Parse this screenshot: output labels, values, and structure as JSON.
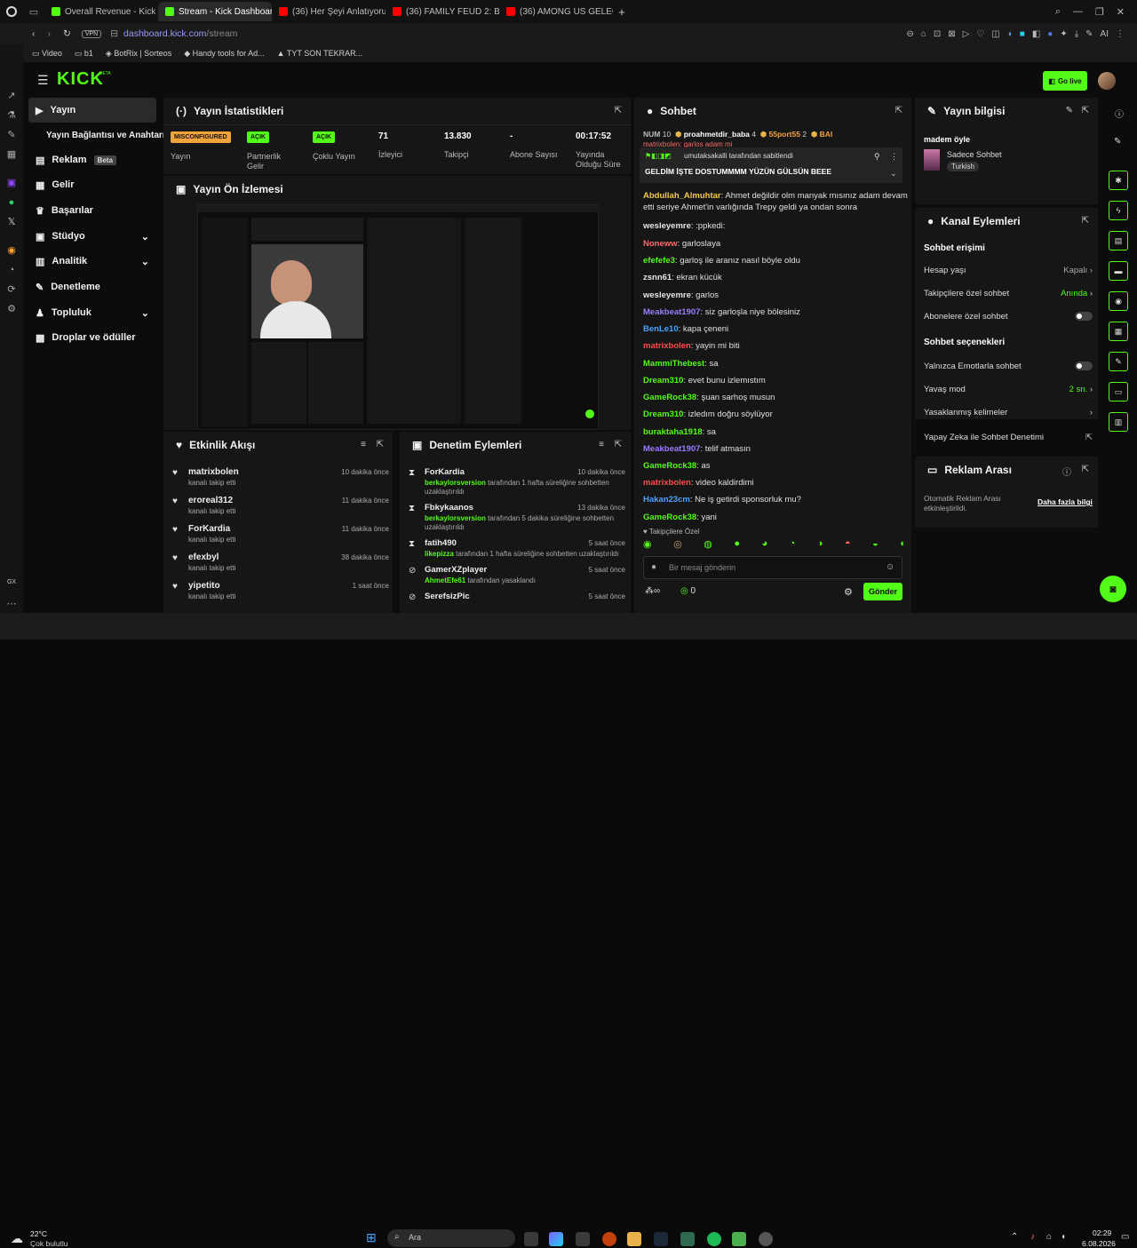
{
  "browser": {
    "tabs": [
      {
        "label": "Overall Revenue - Kick Da",
        "color": "#53fc18"
      },
      {
        "label": "Stream - Kick Dashboard",
        "color": "#53fc18",
        "active": true
      },
      {
        "label": "(36) Her Şeyi Anlatıyorum",
        "color": "#ff0000"
      },
      {
        "label": "(36) FAMILY FEUD 2: BETA",
        "color": "#ff0000"
      },
      {
        "label": "(36) AMONG US GELECEK",
        "color": "#ff0000"
      }
    ],
    "new_tab": "+",
    "vpn": "VPN",
    "url_host": "dashboard.kick.com",
    "url_path": "/stream",
    "ai_label": "AI",
    "bookmarks": [
      "Video",
      "b1",
      "BotRix | Sorteos",
      "Handy tools for Ad...",
      "TYT SON TEKRAR..."
    ]
  },
  "app": {
    "logo": "KICK",
    "logo_tag": "BETA",
    "go_live": "Go live",
    "accent": "#53fc18"
  },
  "sidenav": {
    "items": [
      {
        "label": "Yayın",
        "icon": "broadcast-icon"
      },
      {
        "label": "Yayın Bağlantısı ve Anahtarı",
        "icon": ""
      },
      {
        "label": "Reklam",
        "badge": "Beta",
        "icon": "ad-icon"
      },
      {
        "label": "Gelir",
        "icon": "revenue-icon"
      },
      {
        "label": "Başarılar",
        "icon": "trophy-icon"
      },
      {
        "label": "Stüdyo",
        "icon": "studio-icon"
      },
      {
        "label": "Analitik",
        "icon": "analytics-icon"
      },
      {
        "label": "Denetleme",
        "icon": "moderation-icon"
      },
      {
        "label": "Topluluk",
        "icon": "community-icon"
      },
      {
        "label": "Droplar ve ödüller",
        "icon": "drops-icon"
      }
    ]
  },
  "stats": {
    "title": "Yayın İstatistikleri",
    "items": [
      {
        "value": "MISCONFIGURED",
        "label": "Yayın",
        "badge": "orange"
      },
      {
        "value": "AÇIK",
        "label": "Partnerlik Gelir",
        "badge": "green"
      },
      {
        "value": "AÇIK",
        "label": "Çoklu Yayın",
        "badge": "green"
      },
      {
        "value": "71",
        "label": "İzleyici"
      },
      {
        "value": "13.830",
        "label": "Takipçi"
      },
      {
        "value": "-",
        "label": "Abone Sayısı"
      },
      {
        "value": "00:17:52",
        "label": "Yayında Olduğu Süre"
      }
    ]
  },
  "preview": {
    "title": "Yayın Ön İzlemesi"
  },
  "activity": {
    "title": "Etkinlik Akışı",
    "items": [
      {
        "name": "matrixbolen",
        "sub": "kanalı takip etti",
        "time": "10 dakika önce"
      },
      {
        "name": "eroreal312",
        "sub": "kanalı takip etti",
        "time": "11 dakika önce"
      },
      {
        "name": "ForKardia",
        "sub": "kanalı takip etti",
        "time": "11 dakika önce"
      },
      {
        "name": "efexbyl",
        "sub": "kanalı takip etti",
        "time": "38 dakika önce"
      },
      {
        "name": "yipetito",
        "sub": "kanalı takip etti",
        "time": "1 saat önce"
      }
    ]
  },
  "modlog": {
    "title": "Denetim Eylemleri",
    "items": [
      {
        "name": "ForKardia",
        "by": "berkaylorsversion",
        "text": "tarafından 1 hafta süreliğine sohbetten uzaklaştırıldı",
        "time": "10 dakika önce"
      },
      {
        "name": "Fbkykaanos",
        "by": "berkaylorsversion",
        "text": "tarafından 5 dakika süreliğine sohbetten uzaklaştırıldı",
        "time": "13 dakika önce"
      },
      {
        "name": "fatih490",
        "by": "likepizza",
        "text": "tarafından 1 hafta süreliğine sohbetten uzaklaştırıldı",
        "time": "5 saat önce"
      },
      {
        "name": "GamerXZplayer",
        "by": "AhmetEfe61",
        "text": "tarafından yasaklandı",
        "time": "5 saat önce"
      },
      {
        "name": "SerefsizPic",
        "by": "",
        "text": "",
        "time": "5 saat önce"
      }
    ]
  },
  "chat": {
    "title": "Sohbet",
    "leaderboard": [
      {
        "name": "NUM",
        "count": "10"
      },
      {
        "name": "proahmetdir_baba",
        "count": "4"
      },
      {
        "name": "55port55",
        "count": "2"
      },
      {
        "name": "BAI",
        "count": ""
      }
    ],
    "peek_line": "matrixbolen: garlos adam mi",
    "pinned_by": "umutaksakalli tarafından sabitlendi",
    "pinned_text": "GELDİM İŞTE DOSTUMMMM YÜZÜN GÜLSÜN BEEE",
    "messages": [
      {
        "user": "Abdullah_Almuhtar",
        "color": "#f2c94c",
        "text": "Ahmet değildir olm manyak mısınız adam devam etti seriye Ahmet'in varlığında Trepy geldi ya ondan sonra"
      },
      {
        "user": "wesleyemre",
        "color": "#e6e6e6",
        "text": ":ppkedi:"
      },
      {
        "user": "Noneww",
        "color": "#ff6b6b",
        "text": "garloslaya"
      },
      {
        "user": "efefefe3",
        "color": "#53fc18",
        "text": "garloş ile aranız nasıl böyle oldu"
      },
      {
        "user": "zsnn61",
        "color": "#e6e6e6",
        "text": "ekran kücük"
      },
      {
        "user": "wesleyemre",
        "color": "#e6e6e6",
        "text": "garlos"
      },
      {
        "user": "Meakbeat1907",
        "color": "#9b7bff",
        "text": "siz garloşla niye bölesiniz"
      },
      {
        "user": "BenLe10",
        "color": "#4aa3ff",
        "text": "kapa çeneni"
      },
      {
        "user": "matrixbolen",
        "color": "#ff4d4d",
        "text": "yayin mi biti"
      },
      {
        "user": "MammiThebest",
        "color": "#53fc18",
        "text": "sa"
      },
      {
        "user": "Dream310",
        "color": "#53fc18",
        "text": "evet bunu izlemıstım"
      },
      {
        "user": "GameRock38",
        "color": "#53fc18",
        "text": "şuan sarhoş musun"
      },
      {
        "user": "Dream310",
        "color": "#53fc18",
        "text": "izledım doğru söylüyor"
      },
      {
        "user": "buraktaha1918",
        "color": "#53fc18",
        "text": "sa"
      },
      {
        "user": "Meakbeat1907",
        "color": "#9b7bff",
        "text": "telif atmasın"
      },
      {
        "user": "GameRock38",
        "color": "#53fc18",
        "text": "as"
      },
      {
        "user": "matrixbolen",
        "color": "#ff4d4d",
        "text": "video kaldirdimi"
      },
      {
        "user": "Hakan23cm",
        "color": "#4aa3ff",
        "text": "Ne iş getirdi sponsorluk mu?"
      },
      {
        "user": "GameRock38",
        "color": "#53fc18",
        "text": "yani"
      }
    ],
    "followers_only": "Takipçilere Özel",
    "input_placeholder": "Bir mesaj gönderin",
    "points": "∞",
    "kick_count": "0",
    "send": "Gönder"
  },
  "stream_info": {
    "title": "Yayın bilgisi",
    "stream_title": "madem öyle",
    "category": "Sadece Sohbet",
    "tag": "Turkish"
  },
  "channel_actions": {
    "title": "Kanal Eylemleri",
    "chat_access": "Sohbet erişimi",
    "account_age": {
      "label": "Hesap yaşı",
      "value": "Kapalı"
    },
    "followers_chat": {
      "label": "Takipçilere özel sohbet",
      "value": "Anında"
    },
    "subs_chat": {
      "label": "Abonelere özel sohbet"
    },
    "chat_options": "Sohbet seçenekleri",
    "emote_only": {
      "label": "Yalnızca Emotlarla sohbet"
    },
    "slow_mode": {
      "label": "Yavaş mod",
      "value": "2 sn."
    },
    "banned_words": {
      "label": "Yasaklanmış kelimeler"
    },
    "ai_mod": {
      "label": "Yapay Zeka ile Sohbet Denetimi"
    }
  },
  "ad_break": {
    "title": "Reklam Arası",
    "text": "Otomatik Reklam Arası etkinleştirildi.",
    "link": "Daha fazla bilgi"
  },
  "taskbar": {
    "weather_temp": "22°C",
    "weather_text": "Çok bulutlu",
    "search": "Ara",
    "time": "02:29",
    "date": "6.08.2026"
  },
  "leftrail": {
    "gx": "GX"
  }
}
